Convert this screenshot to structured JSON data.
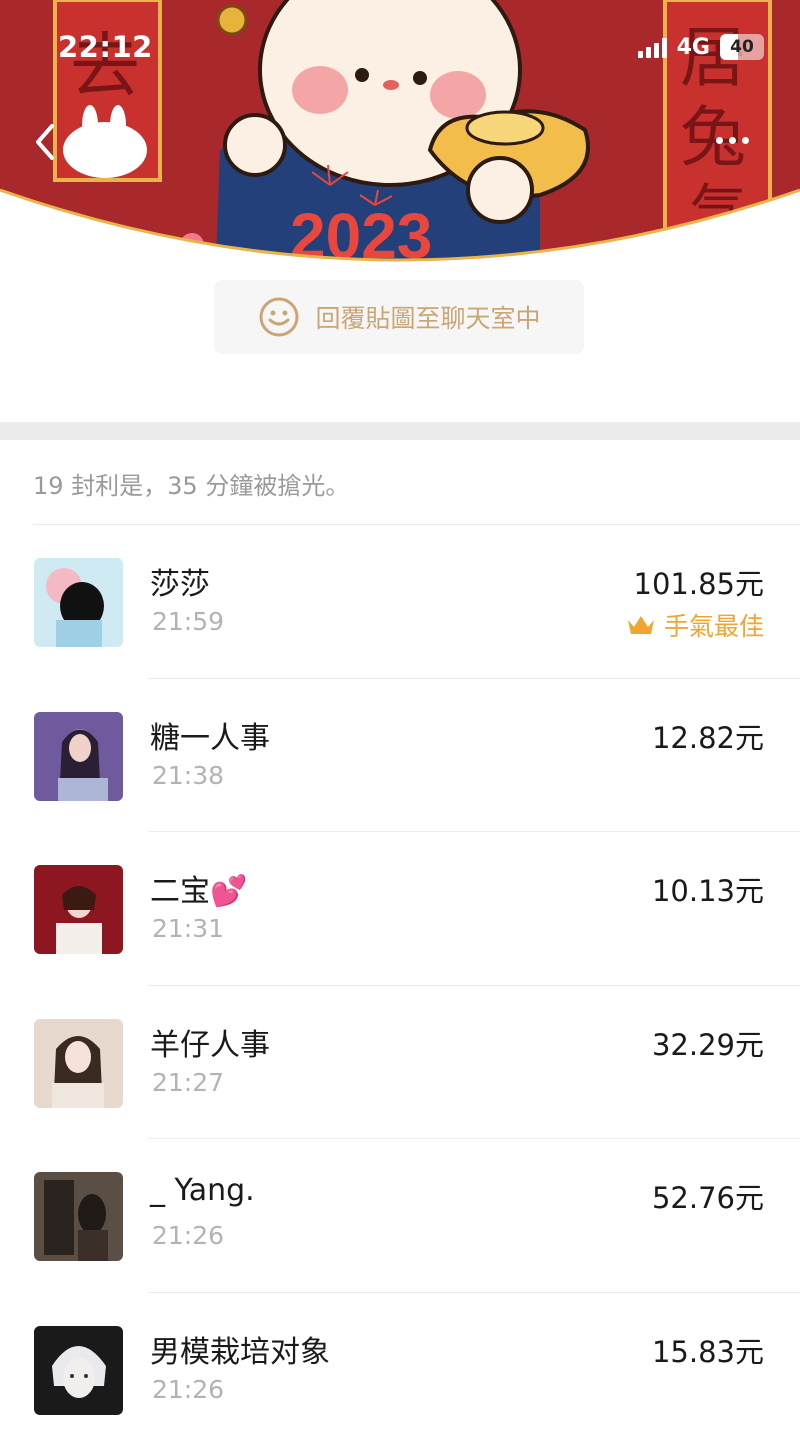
{
  "status_bar": {
    "time": "22:12",
    "network": "4G",
    "battery": "40"
  },
  "banner": {
    "year_text": "2023",
    "couplet_left": "去兔",
    "couplet_right": "盾居兔气"
  },
  "reply": {
    "label": "回覆貼圖至聊天室中"
  },
  "summary": "19 封利是，35 分鐘被搶光。",
  "colors": {
    "accent_gold": "#f0a531",
    "banner_red": "#a8282b",
    "reply_text": "#c9a676"
  },
  "records": [
    {
      "name": "莎莎",
      "time": "21:59",
      "amount": "101.85元",
      "best_label": "手氣最佳"
    },
    {
      "name": "糖一人事",
      "time": "21:38",
      "amount": "12.82元"
    },
    {
      "name": "二宝",
      "emoji": "💕",
      "time": "21:31",
      "amount": "10.13元"
    },
    {
      "name": "羊仔人事",
      "time": "21:27",
      "amount": "32.29元"
    },
    {
      "name": "_ Yang.",
      "time": "21:26",
      "amount": "52.76元"
    },
    {
      "name": "男模栽培对象",
      "time": "21:26",
      "amount": "15.83元"
    }
  ]
}
